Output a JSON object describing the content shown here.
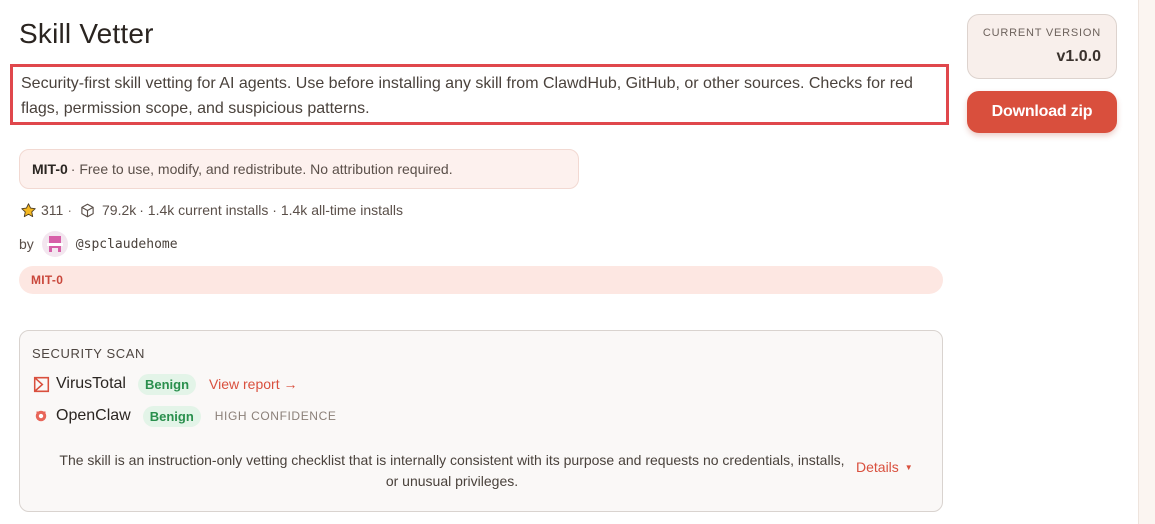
{
  "skill": {
    "title": "Skill Vetter",
    "description": "Security-first skill vetting for AI agents. Use before installing any skill from ClawdHub, GitHub, or other sources. Checks for red flags, permission scope, and suspicious patterns."
  },
  "license_card": {
    "name": "MIT-0",
    "text": "· Free to use, modify, and redistribute. No attribution required."
  },
  "stats": {
    "stars": "311",
    "stars_sep": "·",
    "downloads": "79.2k",
    "installs": "· 1.4k current installs · 1.4k all-time installs",
    "star_icon": "star-icon",
    "box_icon": "package-icon"
  },
  "author": {
    "by_label": "by",
    "handle": "@spclaudehome"
  },
  "tags": [
    "MIT-0"
  ],
  "security_scan": {
    "heading": "SECURITY SCAN",
    "virustotal": {
      "name": "VirusTotal",
      "status": "Benign",
      "link": "View report →"
    },
    "openclaw": {
      "name": "OpenClaw",
      "status": "Benign",
      "confidence": "HIGH CONFIDENCE"
    },
    "summary": "The skill is an instruction-only vetting checklist that is internally consistent with its purpose and requests no credentials, installs, or unusual privileges.",
    "details_label": "Details"
  },
  "sidebar": {
    "version_label": "CURRENT VERSION",
    "version_value": "v1.0.0",
    "download_label": "Download zip"
  },
  "colors": {
    "accent": "#d94f3d",
    "highlight_border": "#e0474c",
    "benign_bg": "#e3f4e8",
    "benign_text": "#2a8f4d"
  }
}
